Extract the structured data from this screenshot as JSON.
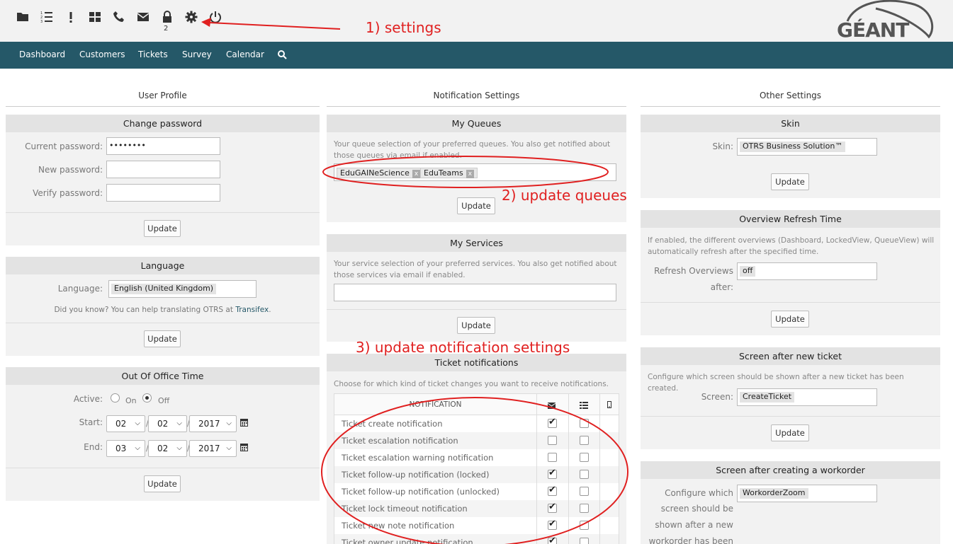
{
  "toolbar": {
    "icons": [
      "folder-icon",
      "ordered-list-icon",
      "exclamation-icon",
      "grid-icon",
      "phone-icon",
      "envelope-icon",
      "lock-icon",
      "gear-icon",
      "power-icon"
    ],
    "lock_count": "2"
  },
  "logo": {
    "text": "GÉANT"
  },
  "nav": {
    "items": [
      "Dashboard",
      "Customers",
      "Tickets",
      "Survey",
      "Calendar"
    ]
  },
  "columns": {
    "left": "User Profile",
    "middle": "Notification Settings",
    "right": "Other Settings"
  },
  "change_password": {
    "title": "Change password",
    "current_label": "Current password:",
    "current_value": "••••••••",
    "new_label": "New password:",
    "verify_label": "Verify password:",
    "update": "Update"
  },
  "language": {
    "title": "Language",
    "label": "Language:",
    "value": "English (United Kingdom)",
    "hint": "Did you know? You can help translating OTRS at ",
    "hint_link": "Transifex",
    "hint_end": ".",
    "update": "Update"
  },
  "out_of_office": {
    "title": "Out Of Office Time",
    "active_label": "Active:",
    "on_label": "On",
    "off_label": "Off",
    "start_label": "Start:",
    "end_label": "End:",
    "start": {
      "day": "02",
      "month": "02",
      "year": "2017"
    },
    "end": {
      "day": "03",
      "month": "02",
      "year": "2017"
    },
    "update": "Update"
  },
  "my_queues": {
    "title": "My Queues",
    "desc": "Your queue selection of your preferred queues. You also get notified about those queues via email if enabled.",
    "tags": [
      "EduGAINeScience",
      "EduTeams"
    ],
    "update": "Update"
  },
  "my_services": {
    "title": "My Services",
    "desc": "Your service selection of your preferred services. You also get notified about those services via email if enabled.",
    "update": "Update"
  },
  "ticket_notifications": {
    "title": "Ticket notifications",
    "desc": "Choose for which kind of ticket changes you want to receive notifications.",
    "col_header": "NOTIFICATION",
    "rows": [
      {
        "label": "Ticket create notification",
        "email": true,
        "web": false
      },
      {
        "label": "Ticket escalation notification",
        "email": false,
        "web": false
      },
      {
        "label": "Ticket escalation warning notification",
        "email": false,
        "web": false
      },
      {
        "label": "Ticket follow-up notification (locked)",
        "email": true,
        "web": false
      },
      {
        "label": "Ticket follow-up notification (unlocked)",
        "email": true,
        "web": false
      },
      {
        "label": "Ticket lock timeout notification",
        "email": true,
        "web": false
      },
      {
        "label": "Ticket new note notification",
        "email": true,
        "web": false
      },
      {
        "label": "Ticket owner update notification",
        "email": true,
        "web": false
      }
    ]
  },
  "skin": {
    "title": "Skin",
    "label": "Skin:",
    "value": "OTRS Business Solution™",
    "update": "Update"
  },
  "refresh": {
    "title": "Overview Refresh Time",
    "desc": "If enabled, the different overviews (Dashboard, LockedView, QueueView) will automatically refresh after the specified time.",
    "label1": "Refresh Overviews",
    "label2": "after:",
    "value": "off",
    "update": "Update"
  },
  "screen_after_ticket": {
    "title": "Screen after new ticket",
    "desc": "Configure which screen should be shown after a new ticket has been created.",
    "label": "Screen:",
    "value": "CreateTicket",
    "update": "Update"
  },
  "screen_after_workorder": {
    "title": "Screen after creating a workorder",
    "label_lines": [
      "Configure which",
      "screen should be",
      "shown after a new",
      "workorder has been"
    ],
    "value": "WorkorderZoom"
  },
  "annotations": {
    "a1": "1) settings",
    "a2": "2) update queues",
    "a3": "3) update notification settings",
    "color": "#e02020"
  }
}
